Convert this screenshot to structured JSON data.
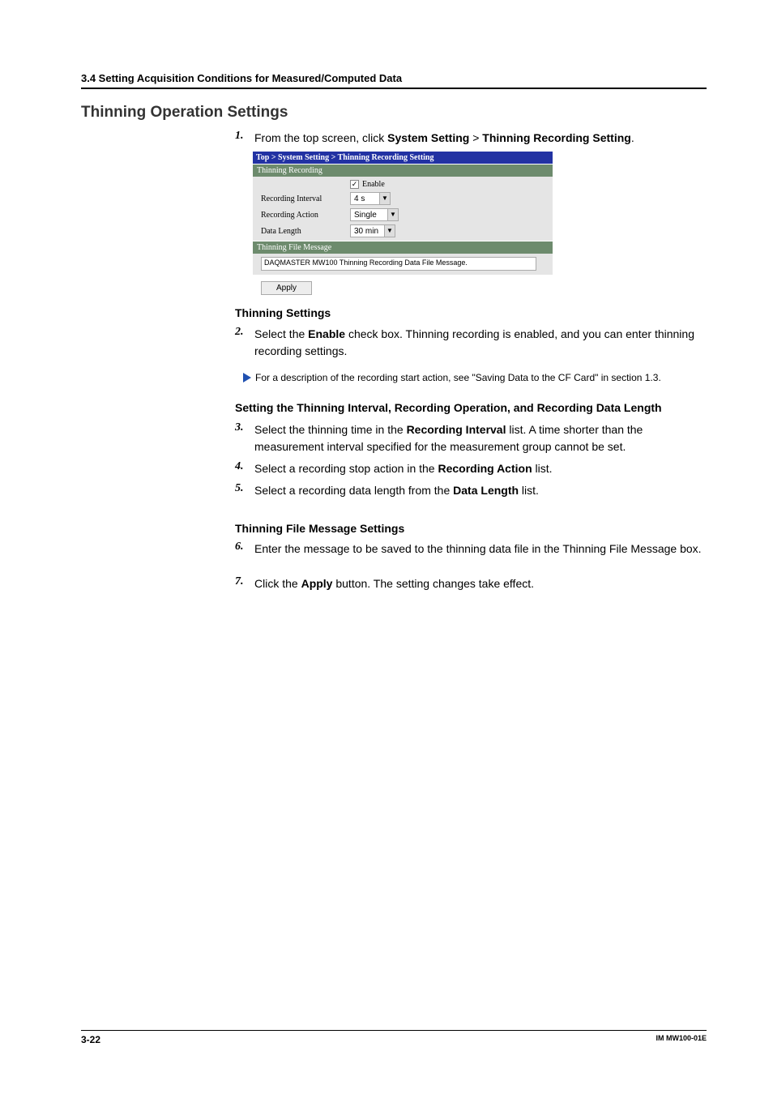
{
  "section_header": "3.4  Setting Acquisition Conditions for Measured/Computed Data",
  "main_heading": "Thinning Operation Settings",
  "step1": {
    "num": "1.",
    "text_before": "From the top screen, click ",
    "b1": "System Setting",
    "sep": " > ",
    "b2": "Thinning Recording Setting",
    "after": "."
  },
  "screenshot": {
    "breadcrumb": "Top > System Setting > Thinning Recording Setting",
    "panel1": "Thinning Recording",
    "rows": {
      "enable_label": "",
      "enable_text": "Enable",
      "interval_label": "Recording Interval",
      "interval_val": "4 s",
      "action_label": "Recording Action",
      "action_val": "Single",
      "length_label": "Data Length",
      "length_val": "30 min"
    },
    "panel2": "Thinning File Message",
    "text_input": "DAQMASTER MW100 Thinning Recording Data File Message.",
    "button": "Apply"
  },
  "sub1": "Thinning Settings",
  "step2": {
    "num": "2.",
    "t1": "Select the ",
    "b1": "Enable",
    "t2": " check box. Thinning recording is enabled, and you can enter thinning recording settings."
  },
  "note": "For a description of the recording start action, see \"Saving Data to the CF Card\" in section 1.3.",
  "sub2": "Setting the Thinning Interval, Recording Operation, and Recording Data Length",
  "step3": {
    "num": "3.",
    "t1": "Select the thinning time in the ",
    "b1": "Recording Interval",
    "t2": " list. A time shorter than the measurement interval specified for the measurement group cannot be set."
  },
  "step4": {
    "num": "4.",
    "t1": "Select a recording stop action in the ",
    "b1": "Recording Action",
    "t2": " list."
  },
  "step5": {
    "num": "5.",
    "t1": "Select a recording data length from the ",
    "b1": "Data Length",
    "t2": " list."
  },
  "sub3": "Thinning File Message Settings",
  "step6": {
    "num": "6.",
    "t1": "Enter the message to be saved to the thinning data file in the Thinning File Message box."
  },
  "step7": {
    "num": "7.",
    "t1": "Click the ",
    "b1": "Apply",
    "t2": " button. The setting changes take effect."
  },
  "footer": {
    "page": "3-22",
    "doc": "IM MW100-01E"
  }
}
